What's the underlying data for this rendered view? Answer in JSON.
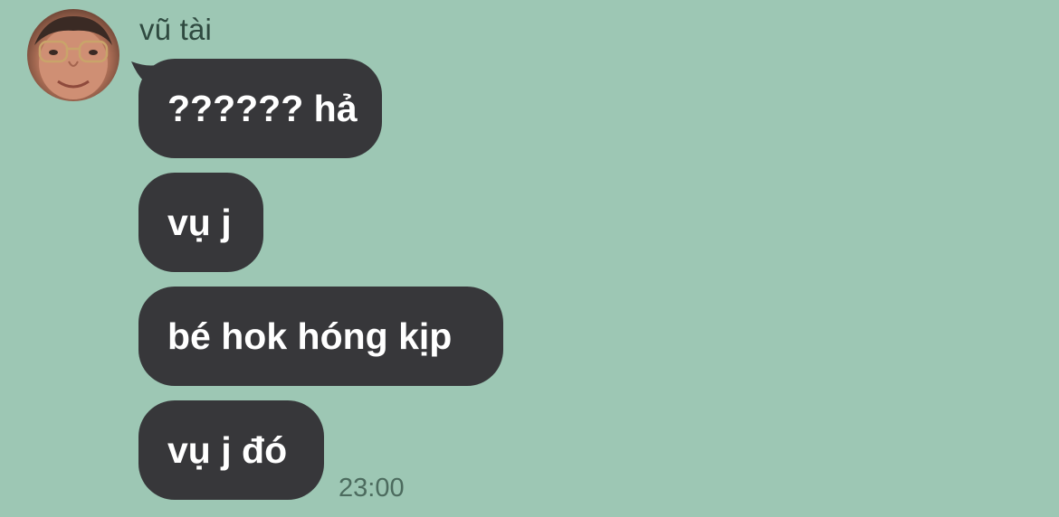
{
  "conversation": {
    "sender_name": "vũ tài",
    "avatar_icon": "user-avatar-photo",
    "messages": [
      {
        "text": "?????? hả"
      },
      {
        "text": "vụ j"
      },
      {
        "text": "bé hok hóng kịp"
      },
      {
        "text": "vụ j đó"
      }
    ],
    "timestamp": "23:00"
  },
  "colors": {
    "background": "#9dc7b4",
    "bubble": "#37373a",
    "bubble_text": "#ffffff",
    "name_text": "#2f4a40",
    "time_text": "#4c6b5e"
  }
}
